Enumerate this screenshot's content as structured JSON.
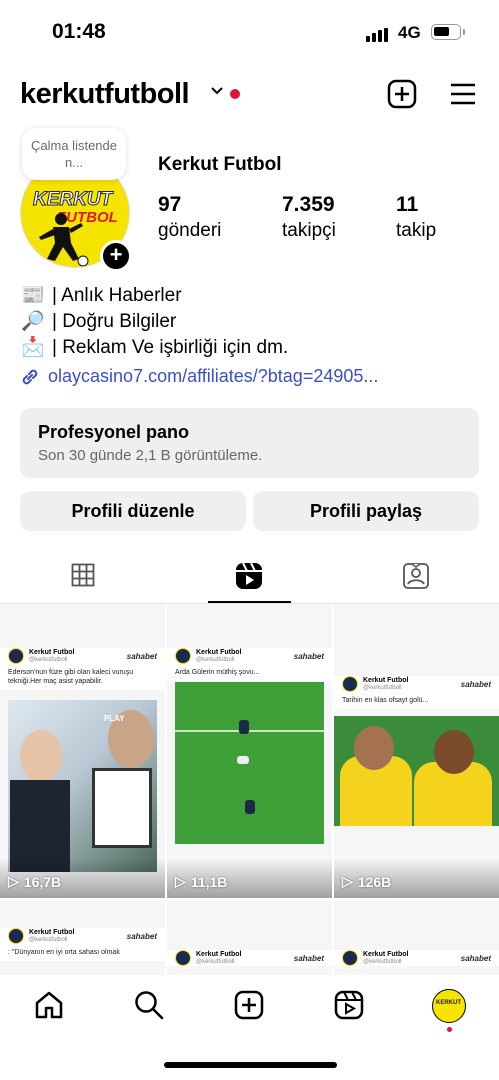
{
  "status_bar": {
    "time": "01:48",
    "network": "4G"
  },
  "header": {
    "username": "kerkutfutboll",
    "icons": [
      "chevron-down-icon",
      "new-post-icon",
      "menu-icon"
    ]
  },
  "profile": {
    "note_bubble": "Çalma listende n...",
    "avatar": {
      "line1": "KERKUT",
      "line2": "FUTBOL"
    },
    "full_name": "Kerkut Futbol",
    "stats": [
      {
        "value": "97",
        "label": "gönderi"
      },
      {
        "value": "7.359",
        "label": "takipçi"
      },
      {
        "value": "11",
        "label": "takip"
      }
    ],
    "bio": [
      {
        "emoji": "📰",
        "text": "| Anlık Haberler"
      },
      {
        "emoji": "🔎",
        "text": "| Doğru Bilgiler"
      },
      {
        "emoji": "📩",
        "text": "| Reklam Ve işbirliği için dm."
      }
    ],
    "link": "olaycasino7.com/affiliates/?btag=24905..."
  },
  "dashboard": {
    "title": "Profesyonel pano",
    "subtitle": "Son 30 günde 2,1 B görüntüleme."
  },
  "buttons": {
    "edit": "Profili düzenle",
    "share": "Profili paylaş"
  },
  "tabs": [
    {
      "name": "grid",
      "icon": "grid-icon"
    },
    {
      "name": "reels",
      "icon": "reels-icon",
      "active": true
    },
    {
      "name": "tagged",
      "icon": "tagged-icon"
    }
  ],
  "posts": [
    {
      "account": "Kerkut Futbol",
      "handle": "@kerkutfutboll",
      "sponsor": "sahabet",
      "caption": "Ederson'nun füze gibi olan kaleci vuruşu tekniği.Her maç asist yapabilir.",
      "overlay": "PLAY",
      "views": "16,7B"
    },
    {
      "account": "Kerkut Futbol",
      "handle": "@kerkutfutboll",
      "sponsor": "sahabet",
      "caption": "Arda Gülerin müthiş şovu...",
      "views": "11,1B"
    },
    {
      "account": "Kerkut Futbol",
      "handle": "@kerkutfutboll",
      "sponsor": "sahabet",
      "caption": "Tarihin en klas ofsayt golü...",
      "views": "126B"
    },
    {
      "account": "Kerkut Futbol",
      "handle": "@kerkutfutboll",
      "sponsor": "sahabet",
      "caption": ": \"Dünyanın en iyi orta sahası olmak"
    },
    {
      "account": "Kerkut Futbol",
      "handle": "@kerkutfutboll",
      "sponsor": "sahabet",
      "caption": ""
    },
    {
      "account": "Kerkut Futbol",
      "handle": "@kerkutfutboll",
      "sponsor": "sahabet",
      "caption": ""
    }
  ],
  "bottom_nav": [
    "home-icon",
    "search-icon",
    "create-icon",
    "reels-icon",
    "profile-avatar"
  ],
  "colors": {
    "accent_red": "#e0123a",
    "link_blue": "#3a4fc6",
    "button_bg": "#efeff0",
    "avatar_yellow": "#f5e400"
  }
}
